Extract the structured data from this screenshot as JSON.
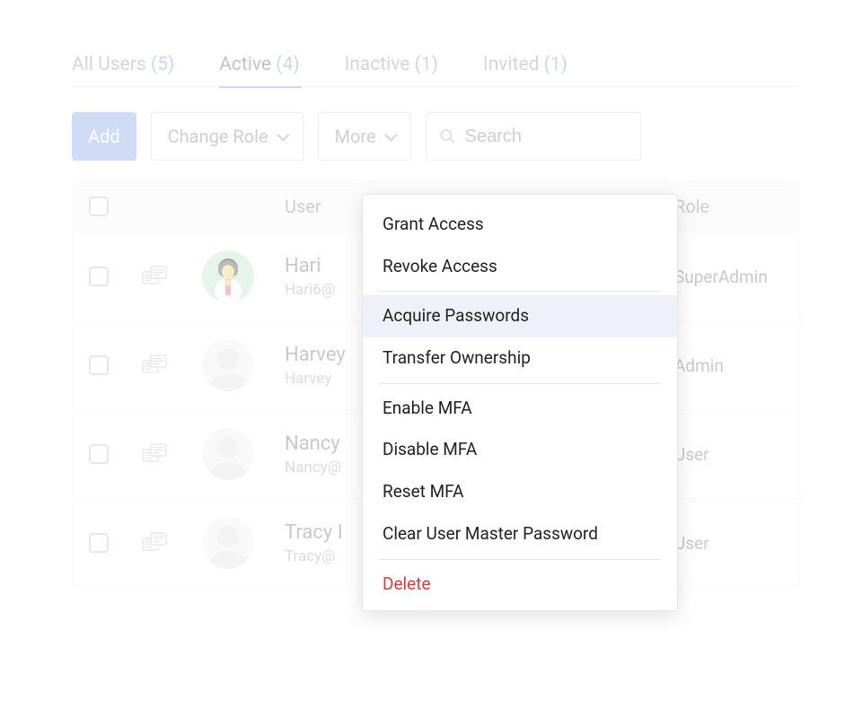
{
  "tabs": [
    {
      "label": "All Users",
      "count": "(5)"
    },
    {
      "label": "Active",
      "count": "(4)"
    },
    {
      "label": "Inactive",
      "count": "(1)"
    },
    {
      "label": "Invited",
      "count": "(1)"
    }
  ],
  "toolbar": {
    "add_label": "Add",
    "change_role_label": "Change Role",
    "more_label": "More",
    "search_placeholder": "Search"
  },
  "columns": {
    "user": "User",
    "role": "Role"
  },
  "rows": [
    {
      "name": "Hari",
      "email": "Hari6@",
      "role": "SuperAdmin"
    },
    {
      "name": "Harvey",
      "email": "Harvey",
      "role": "Admin"
    },
    {
      "name": "Nancy",
      "email": "Nancy@",
      "role": "User"
    },
    {
      "name": "Tracy I",
      "email": "Tracy@",
      "role": "User"
    }
  ],
  "dropdown": {
    "grant_access": "Grant Access",
    "revoke_access": "Revoke Access",
    "acquire_passwords": "Acquire Passwords",
    "transfer_ownership": "Transfer Ownership",
    "enable_mfa": "Enable MFA",
    "disable_mfa": "Disable MFA",
    "reset_mfa": "Reset MFA",
    "clear_master_pw": "Clear User Master Password",
    "delete": "Delete"
  }
}
